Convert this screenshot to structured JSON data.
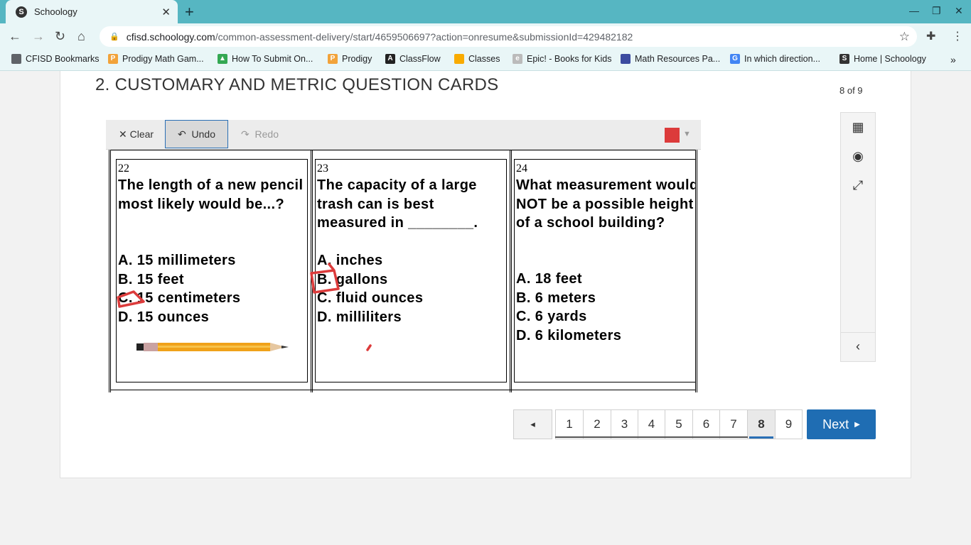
{
  "browser": {
    "tab_title": "Schoology",
    "tab_favicon": "S",
    "url_host": "cfisd.schoology.com",
    "url_path": "/common-assessment-delivery/start/4659506697?action=onresume&submissionId=429482182",
    "icons": [
      "back-icon",
      "forward-icon",
      "reload-icon",
      "home-icon",
      "lock-icon",
      "star-icon",
      "extensions-icon",
      "menu-icon",
      "minimize-icon",
      "restore-icon",
      "close-window-icon"
    ]
  },
  "bookmarks": [
    {
      "label": "CFISD Bookmarks",
      "icon": "folder-icon"
    },
    {
      "label": "Prodigy Math Gam...",
      "icon": "prodigy-icon"
    },
    {
      "label": "How To Submit On...",
      "icon": "drive-icon"
    },
    {
      "label": "Prodigy",
      "icon": "prodigy-icon"
    },
    {
      "label": "ClassFlow",
      "icon": "classflow-icon"
    },
    {
      "label": "Classes",
      "icon": "classroom-icon"
    },
    {
      "label": "Epic! - Books for Kids",
      "icon": "epic-icon"
    },
    {
      "label": "Math Resources Pa...",
      "icon": "page-icon"
    },
    {
      "label": "In which direction...",
      "icon": "google-icon"
    },
    {
      "label": "Home | Schoology",
      "icon": "schoology-icon"
    }
  ],
  "assessment": {
    "title": "2. CUSTOMARY AND METRIC QUESTION CARDS",
    "counter": "8 of 9"
  },
  "drawing_toolbar": {
    "clear": "Clear",
    "undo": "Undo",
    "redo": "Redo",
    "pen_color": "#dc3b3b"
  },
  "cards": [
    {
      "number": "22",
      "question": "The length of a new pencil most likely would be...?",
      "options": [
        "A. 15 millimeters",
        "B. 15 feet",
        "C. 15 centimeters",
        "D. 15 ounces"
      ]
    },
    {
      "number": "23",
      "question": "The capacity of a large trash can is best measured in ________.",
      "options": [
        "A. inches",
        "B. gallons",
        "C. fluid ounces",
        "D. milliliters"
      ]
    },
    {
      "number": "24",
      "question": "What measurement would NOT be a possible height of a school building?",
      "options": [
        "A. 18 feet",
        "B. 6 meters",
        "C. 6 yards",
        "D. 6 kilometers"
      ]
    }
  ],
  "pagination": {
    "prev": "◂",
    "pages": [
      "1",
      "2",
      "3",
      "4",
      "5",
      "6",
      "7",
      "8",
      "9"
    ],
    "current": "8",
    "next": "Next"
  }
}
